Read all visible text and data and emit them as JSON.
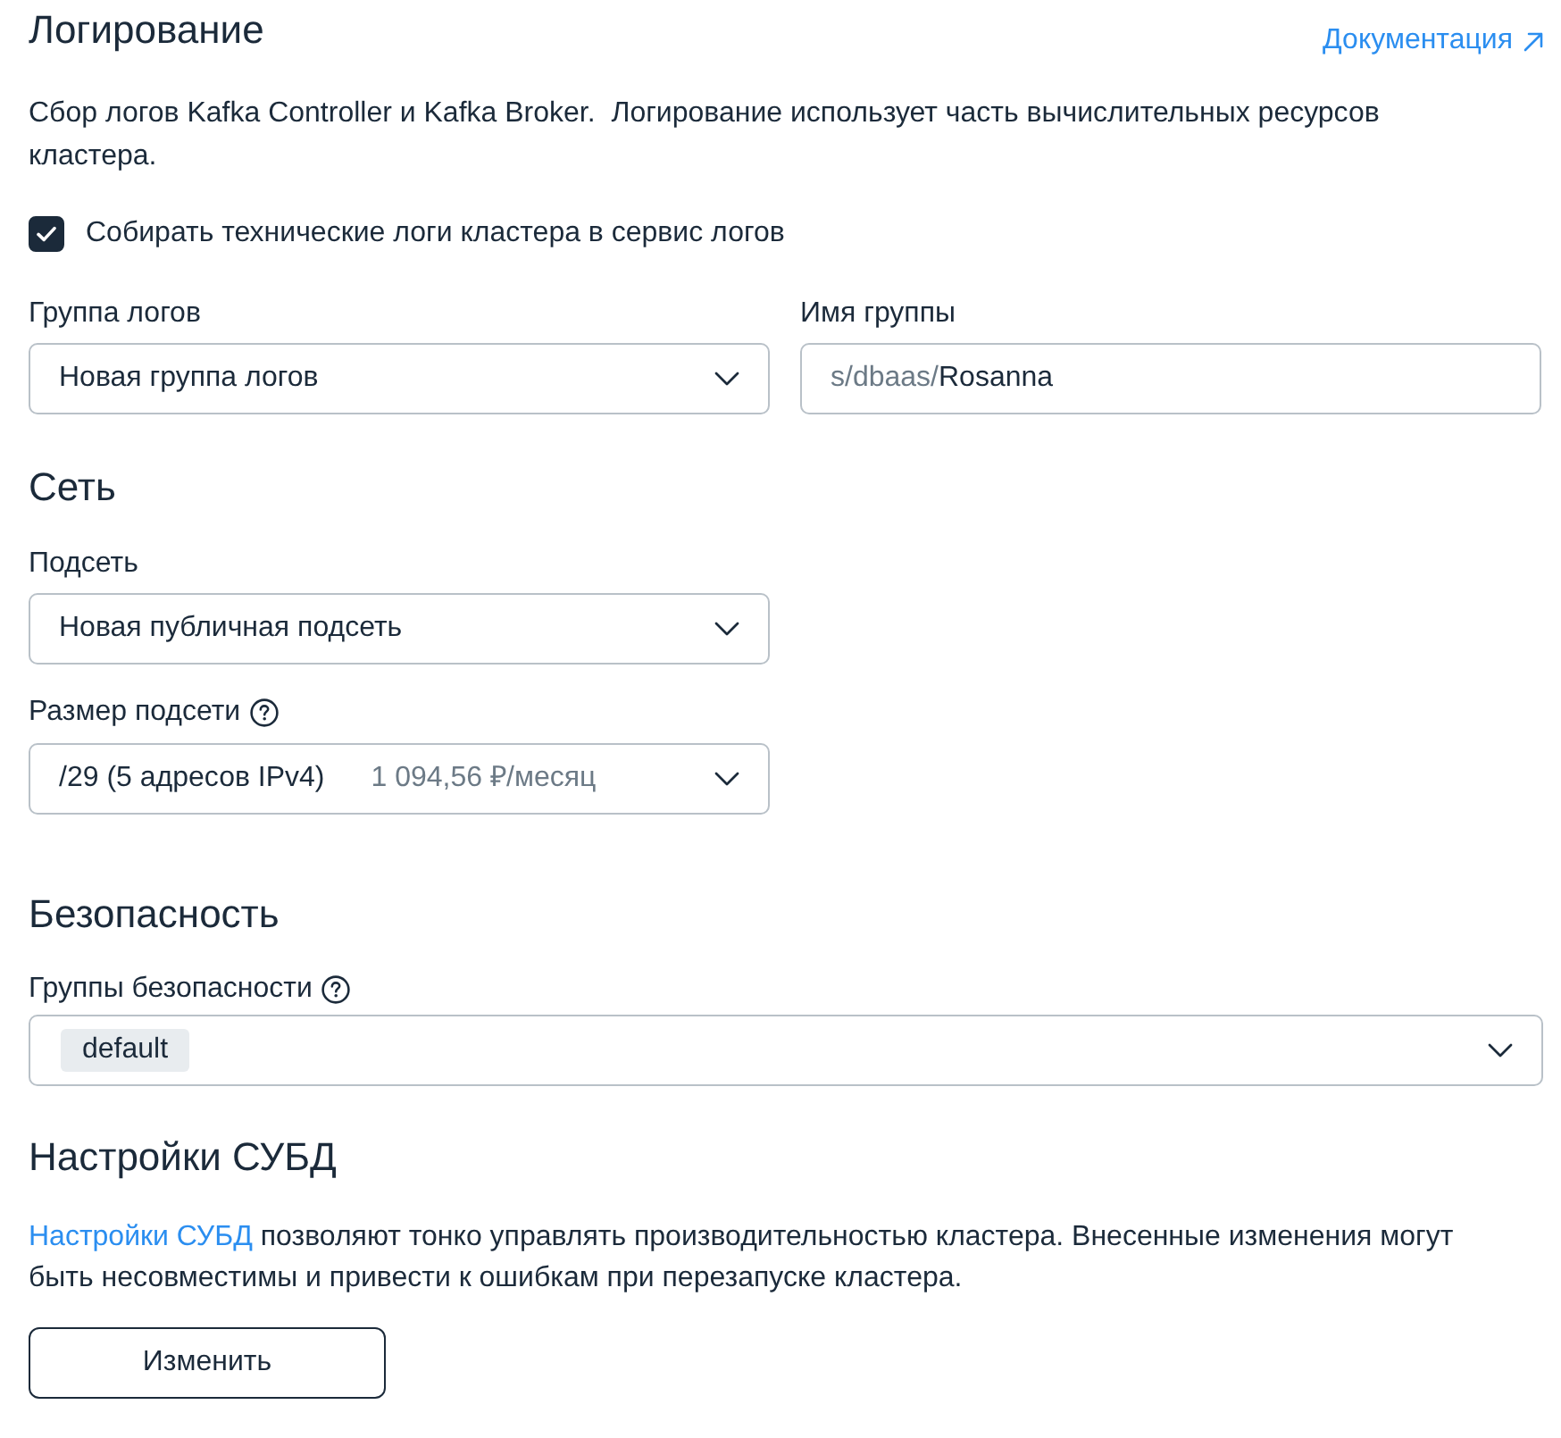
{
  "logging": {
    "title": "Логирование",
    "doc_link": "Документация",
    "description": "Сбор логов Kafka Controller и Kafka Broker.  Логирование использует часть вычислительных ресурсов кластера.",
    "collect_checkbox": {
      "label": "Собирать технические логи кластера в сервис логов",
      "checked": true
    },
    "log_group": {
      "label": "Группа логов",
      "value": "Новая группа логов"
    },
    "group_name": {
      "label": "Имя группы",
      "prefix": "s/dbaas/",
      "value": "Rosanna"
    }
  },
  "network": {
    "title": "Сеть",
    "subnet": {
      "label": "Подсеть",
      "value": "Новая публичная подсеть"
    },
    "subnet_size": {
      "label": "Размер подсети",
      "value": "/29 (5 адресов IPv4)",
      "price": "1 094,56 ₽/месяц"
    }
  },
  "security": {
    "title": "Безопасность",
    "security_groups": {
      "label": "Группы безопасности",
      "tags": [
        "default"
      ]
    }
  },
  "dbms_settings": {
    "title": "Настройки СУБД",
    "link": "Настройки СУБД",
    "description": " позволяют тонко управлять производительностью кластера. Внесенные изменения могут быть несовместимы и привести к ошибкам при перезапуске кластера.",
    "button": "Изменить"
  }
}
